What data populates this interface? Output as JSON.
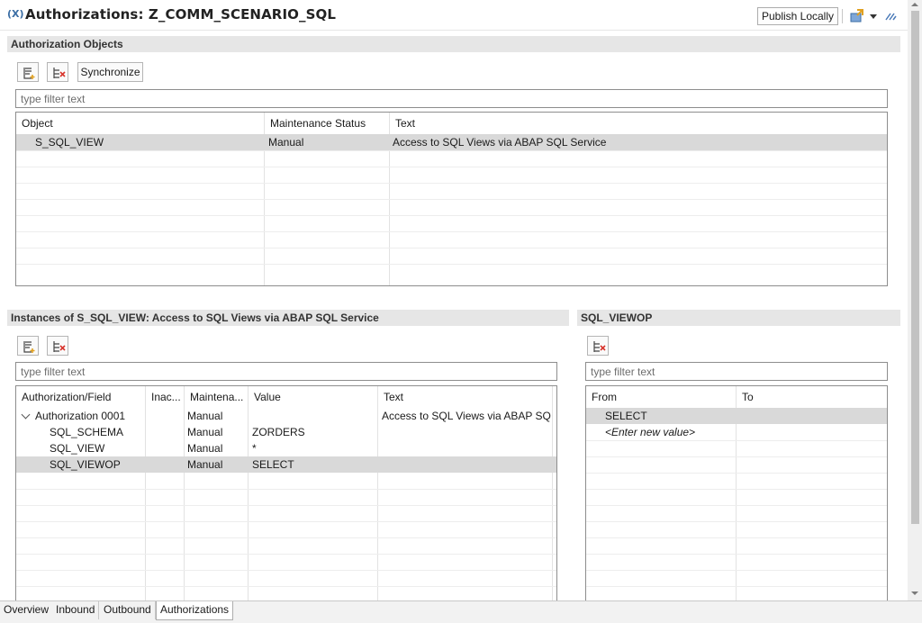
{
  "header": {
    "icon_text": "(X)",
    "title": "Authorizations: Z_COMM_SCENARIO_SQL",
    "publish_label": "Publish Locally"
  },
  "auth_objects": {
    "section_title": "Authorization Objects",
    "synchronize_label": "Synchronize",
    "filter_placeholder": "type filter text",
    "columns": [
      "Object",
      "Maintenance Status",
      "Text"
    ],
    "rows": [
      {
        "object": "S_SQL_VIEW",
        "status": "Manual",
        "text": "Access to SQL Views via ABAP SQL Service"
      }
    ]
  },
  "instances": {
    "section_title": "Instances of S_SQL_VIEW: Access to SQL Views via ABAP SQL Service",
    "filter_placeholder": "type filter text",
    "columns": [
      "Authorization/Field",
      "Inac...",
      "Maintena...",
      "Value",
      "Text"
    ],
    "rows": [
      {
        "field": "Authorization 0001",
        "inactive": "",
        "maintenance": "Manual",
        "value": "",
        "text": "Access to SQL Views via ABAP SQL Service"
      },
      {
        "field": "SQL_SCHEMA",
        "inactive": "",
        "maintenance": "Manual",
        "value": "ZORDERS",
        "text": ""
      },
      {
        "field": "SQL_VIEW",
        "inactive": "",
        "maintenance": "Manual",
        "value": "*",
        "text": ""
      },
      {
        "field": "SQL_VIEWOP",
        "inactive": "",
        "maintenance": "Manual",
        "value": "SELECT",
        "text": ""
      }
    ]
  },
  "field_values": {
    "section_title": "SQL_VIEWOP",
    "filter_placeholder": "type filter text",
    "columns": [
      "From",
      "To"
    ],
    "rows": [
      {
        "from": "SELECT",
        "to": ""
      },
      {
        "from": "<Enter new value>",
        "to": ""
      }
    ]
  },
  "tabs": [
    "Overview",
    "Inbound",
    "Outbound",
    "Authorizations"
  ],
  "colors": {
    "section_bg": "#e6e6e6",
    "selected_row": "#d9d9d9",
    "accent": "#3b6ea5"
  }
}
